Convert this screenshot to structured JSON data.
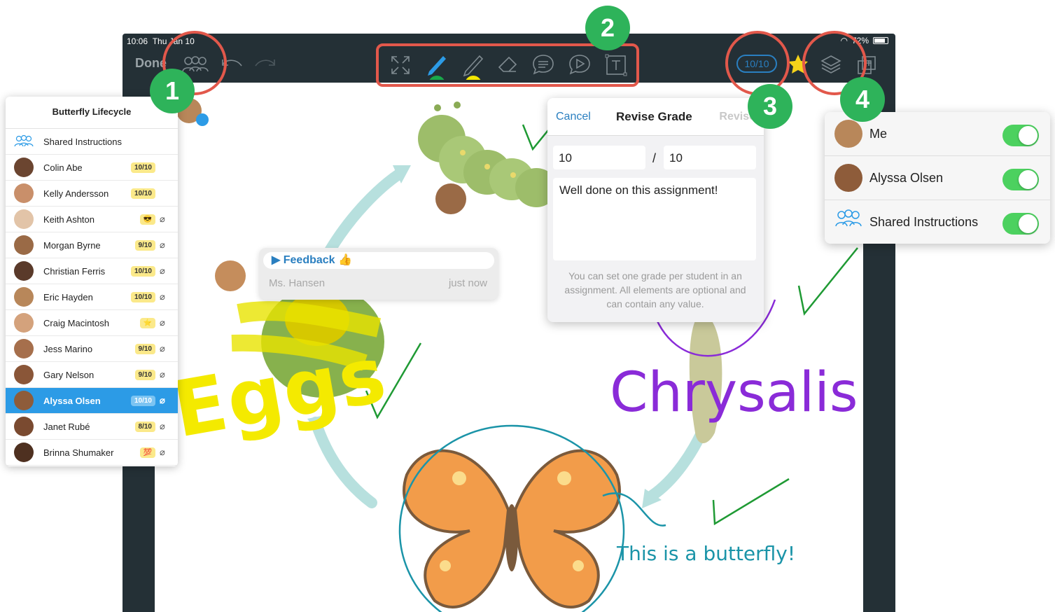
{
  "status": {
    "time": "10:06",
    "date": "Thu Jan 10",
    "battery": "72%"
  },
  "toolbar": {
    "done_label": "Done"
  },
  "grade_pill": "10/10",
  "callouts": [
    "1",
    "2",
    "3",
    "4"
  ],
  "student_panel": {
    "title": "Butterfly Lifecycle",
    "shared_label": "Shared Instructions",
    "students": [
      {
        "name": "Colin Abe",
        "grade": "10/10",
        "clip": false
      },
      {
        "name": "Kelly Andersson",
        "grade": "10/10",
        "clip": false
      },
      {
        "name": "Keith Ashton",
        "grade": "😎",
        "clip": true
      },
      {
        "name": "Morgan Byrne",
        "grade": "9/10",
        "clip": true
      },
      {
        "name": "Christian Ferris",
        "grade": "10/10",
        "clip": true
      },
      {
        "name": "Eric Hayden",
        "grade": "10/10",
        "clip": true
      },
      {
        "name": "Craig Macintosh",
        "grade": "⭐",
        "clip": true
      },
      {
        "name": "Jess Marino",
        "grade": "9/10",
        "clip": true
      },
      {
        "name": "Gary Nelson",
        "grade": "9/10",
        "clip": true
      },
      {
        "name": "Alyssa Olsen",
        "grade": "10/10",
        "clip": true,
        "selected": true
      },
      {
        "name": "Janet Rubé",
        "grade": "8/10",
        "clip": true
      },
      {
        "name": "Brinna Shumaker",
        "grade": "💯",
        "clip": true
      }
    ]
  },
  "revise_grade": {
    "cancel": "Cancel",
    "title": "Revise Grade",
    "confirm": "Revise",
    "score": "10",
    "slash": "/",
    "max": "10",
    "comment": "Well done on this assignment!",
    "help": "You can set one grade per student in an assignment. All elements are optional and can contain any value."
  },
  "layers": [
    {
      "name": "Me",
      "on": true
    },
    {
      "name": "Alyssa Olsen",
      "on": true
    },
    {
      "name": "Shared Instructions",
      "on": true
    }
  ],
  "feedback": {
    "title": "▶ Feedback 👍",
    "author": "Ms. Hansen",
    "time": "just now"
  },
  "canvas_text": {
    "eggs": "Eggs",
    "chrysalis": "Chrysalis",
    "butterfly": "This is a butterfly!"
  },
  "colors": {
    "accent": "#2a7fc0",
    "callout": "#2eb35a",
    "ring": "#e2584b",
    "selected": "#2c9be6",
    "toggle": "#4cd15f"
  }
}
